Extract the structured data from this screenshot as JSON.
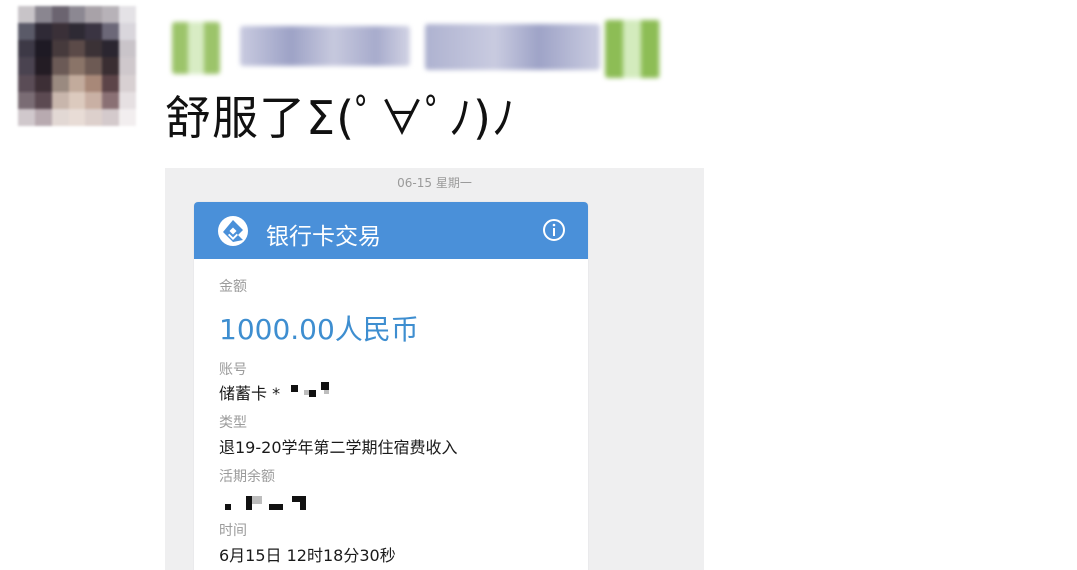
{
  "post": {
    "text": "舒服了Σ(ﾟ∀ﾟﾉ)ﾉ"
  },
  "card": {
    "date": "06-15  星期一",
    "title": "银行卡交易",
    "amount_label": "金额",
    "amount": "1000.00人民币",
    "account_label": "账号",
    "account_value": "储蓄卡 *",
    "type_label": "类型",
    "type_value": "退19-20学年第二学期住宿费收入",
    "balance_label": "活期余额",
    "time_label": "时间",
    "time_value": "6月15日 12时18分30秒"
  },
  "colors": {
    "header_blue": "#4a90d9",
    "amount_blue": "#3e8ed0"
  },
  "icons": [
    "bank-logo-icon",
    "info-icon"
  ]
}
